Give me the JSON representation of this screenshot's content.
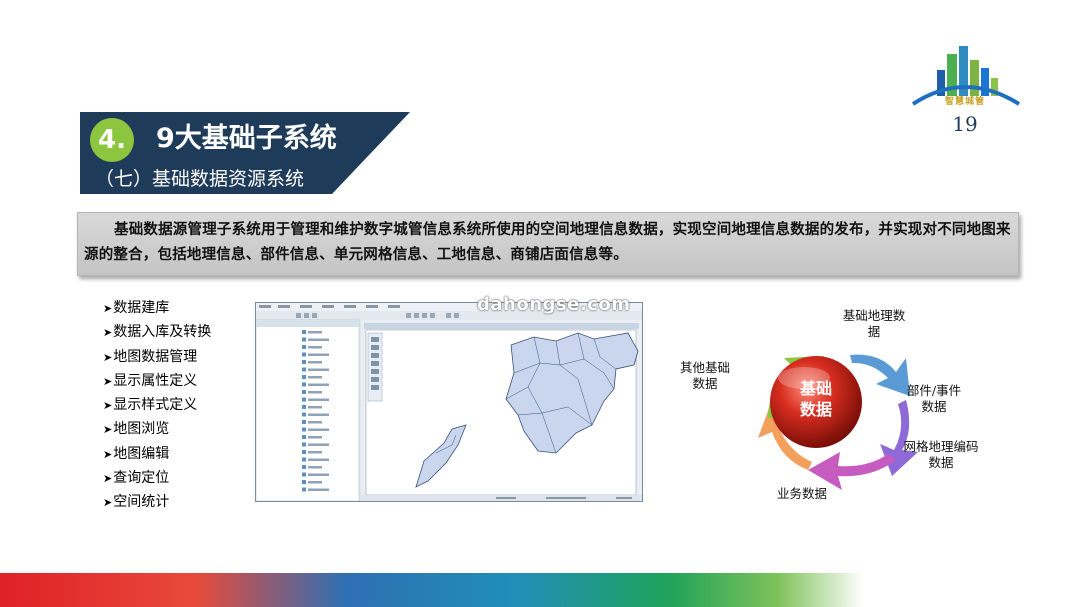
{
  "header": {
    "number": "4.",
    "title": "9大基础子系统",
    "subtitle": "（七）基础数据资源系统",
    "banner_color": "#1f3b5a",
    "number_circle_color": "#8cc63f"
  },
  "logo": {
    "text": "智慧城管",
    "icon": "city-skyline-icon"
  },
  "page_number": "19",
  "description": "基础数据源管理子系统用于管理和维护数字城管信息系统所使用的空间地理信息数据，实现空间地理信息数据的发布，并实现对不同地图来源的整合，包括地理信息、部件信息、单元网格信息、工地信息、商铺店面信息等。",
  "features": [
    "数据建库",
    "数据入库及转换",
    "地图数据管理",
    "显示属性定义",
    "显示样式定义",
    "地图浏览",
    "地图编辑",
    "查询定位",
    "空间统计"
  ],
  "watermark": "dahongse.com",
  "diagram": {
    "center": "基础\n数据",
    "center_line1": "基础",
    "center_line2": "数据",
    "items": [
      {
        "line1": "基础地理数",
        "line2": "据",
        "color": "#5b9bd5"
      },
      {
        "line1": "部件/事件",
        "line2": "数据",
        "color": "#8e6ad8"
      },
      {
        "line1": "网格地理编码",
        "line2": "数据",
        "color": "#c65bc0"
      },
      {
        "line1": "业务数据",
        "line2": "",
        "color": "#f2a05c"
      },
      {
        "line1": "其他基础",
        "line2": "数据",
        "color": "#8cc63f"
      }
    ]
  }
}
